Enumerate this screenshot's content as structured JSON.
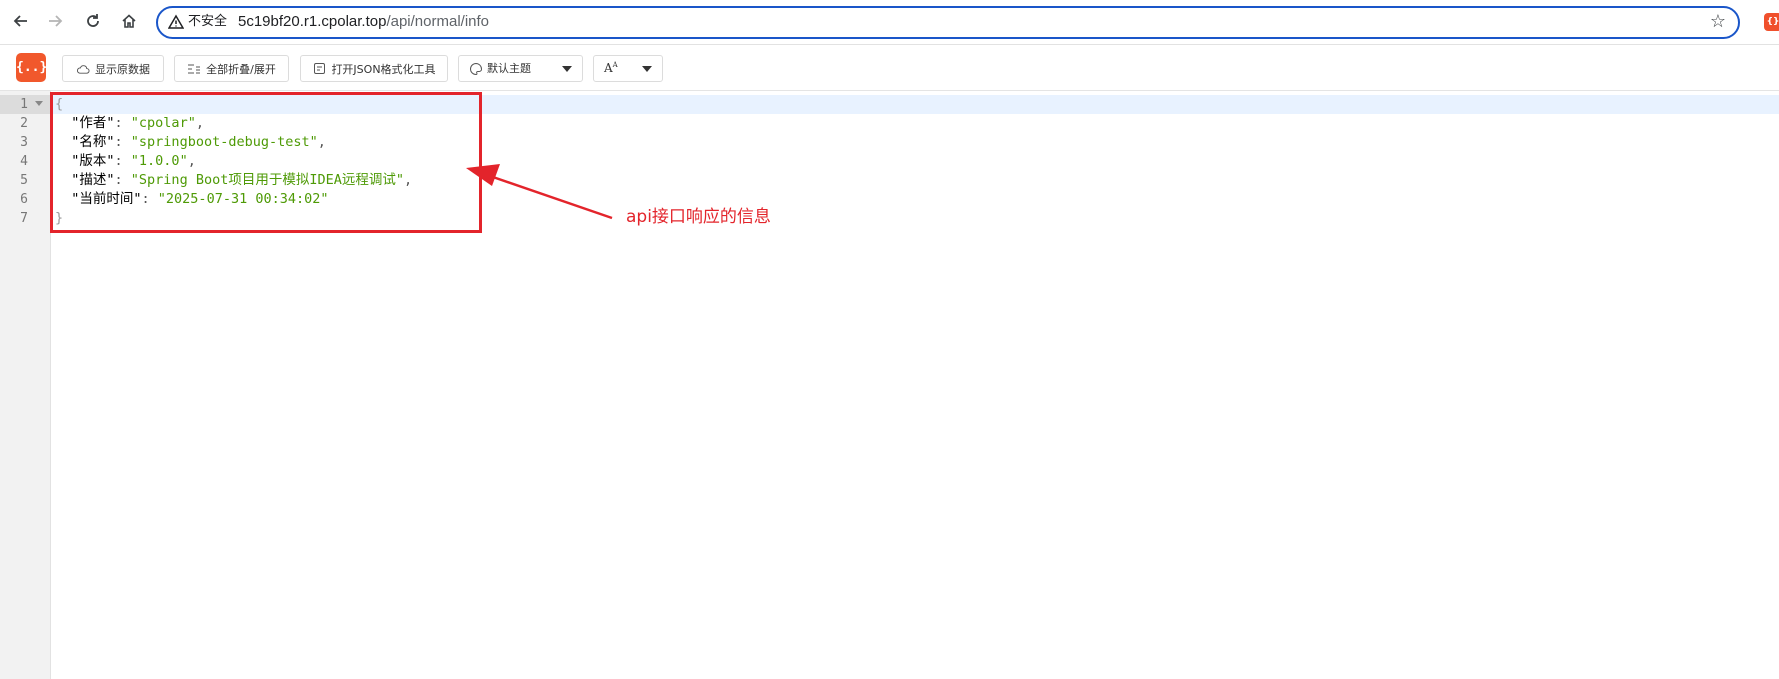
{
  "browser": {
    "back_icon": "arrow-left-icon",
    "forward_icon": "arrow-right-icon",
    "reload_icon": "reload-icon",
    "home_icon": "home-icon",
    "security_warning": "不安全",
    "url_host": "5c19bf20.r1.cpolar.top",
    "url_path": "/api/normal/info",
    "bookmark_icon": "star-icon"
  },
  "toolbar": {
    "logo": "{..}",
    "show_raw_label": "显示原数据",
    "fold_all_label": "全部折叠/展开",
    "open_tool_label": "打开JSON格式化工具",
    "theme_selected": "默认主题",
    "font_icon_label": "A"
  },
  "editor": {
    "line_numbers": [
      "1",
      "2",
      "3",
      "4",
      "5",
      "6",
      "7"
    ],
    "lines": [
      {
        "open": "{"
      },
      {
        "key": "\"作者\"",
        "value": "\"cpolar\"",
        "comma": ","
      },
      {
        "key": "\"名称\"",
        "value": "\"springboot-debug-test\"",
        "comma": ","
      },
      {
        "key": "\"版本\"",
        "value": "\"1.0.0\"",
        "comma": ","
      },
      {
        "key": "\"描述\"",
        "value": "\"Spring Boot项目用于模拟IDEA远程调试\"",
        "comma": ","
      },
      {
        "key": "\"当前时间\"",
        "value": "\"2025-07-31 00:34:02\"",
        "comma": ""
      },
      {
        "close": "}"
      }
    ]
  },
  "annotation": {
    "text": "api接口响应的信息",
    "color": "#e3242b"
  }
}
